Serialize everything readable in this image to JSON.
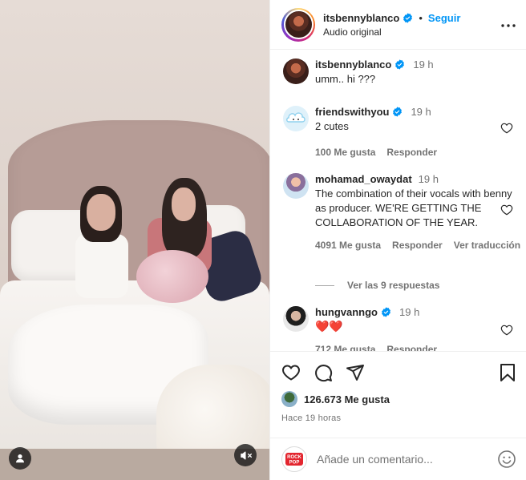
{
  "header": {
    "username": "itsbennyblanco",
    "follow_label": "Seguir",
    "audio_label": "Audio original"
  },
  "comments": [
    {
      "username": "itsbennyblanco",
      "time": "19 h",
      "text": "umm.. hi ???",
      "verified": true,
      "likes": "",
      "reply": "",
      "translate": ""
    },
    {
      "username": "friendswithyou",
      "time": "19 h",
      "text": "2 cutes",
      "verified": true,
      "likes": "100 Me gusta",
      "reply": "Responder",
      "translate": ""
    },
    {
      "username": "mohamad_owaydat",
      "time": "19 h",
      "text": "The combination of their vocals with benny as producer. WE'RE GETTING THE COLLABORATION OF THE YEAR.",
      "verified": false,
      "likes": "4091 Me gusta",
      "reply": "Responder",
      "translate": "Ver traducción"
    },
    {
      "username": "hungvanngo",
      "time": "19 h",
      "text": "❤️❤️",
      "verified": true,
      "likes": "712 Me gusta",
      "reply": "Responder",
      "translate": ""
    }
  ],
  "view_replies": "Ver las 9 respuestas",
  "post": {
    "likes": "126.673 Me gusta",
    "time_ago": "Hace 19 horas"
  },
  "composer": {
    "placeholder": "Añade un comentario..."
  },
  "icons": {
    "verified": "verified-badge-icon",
    "more": "more-options-icon",
    "like": "heart-icon",
    "comment": "comment-icon",
    "share": "share-icon",
    "save": "bookmark-icon",
    "mute": "muted-speaker-icon",
    "tag": "user-tag-icon",
    "emoji": "emoji-icon"
  },
  "colors": {
    "accent": "#0095f6",
    "verified": "#0095f6",
    "heart_red": "#ed4956",
    "text_primary": "#262626",
    "text_secondary": "#737373"
  }
}
